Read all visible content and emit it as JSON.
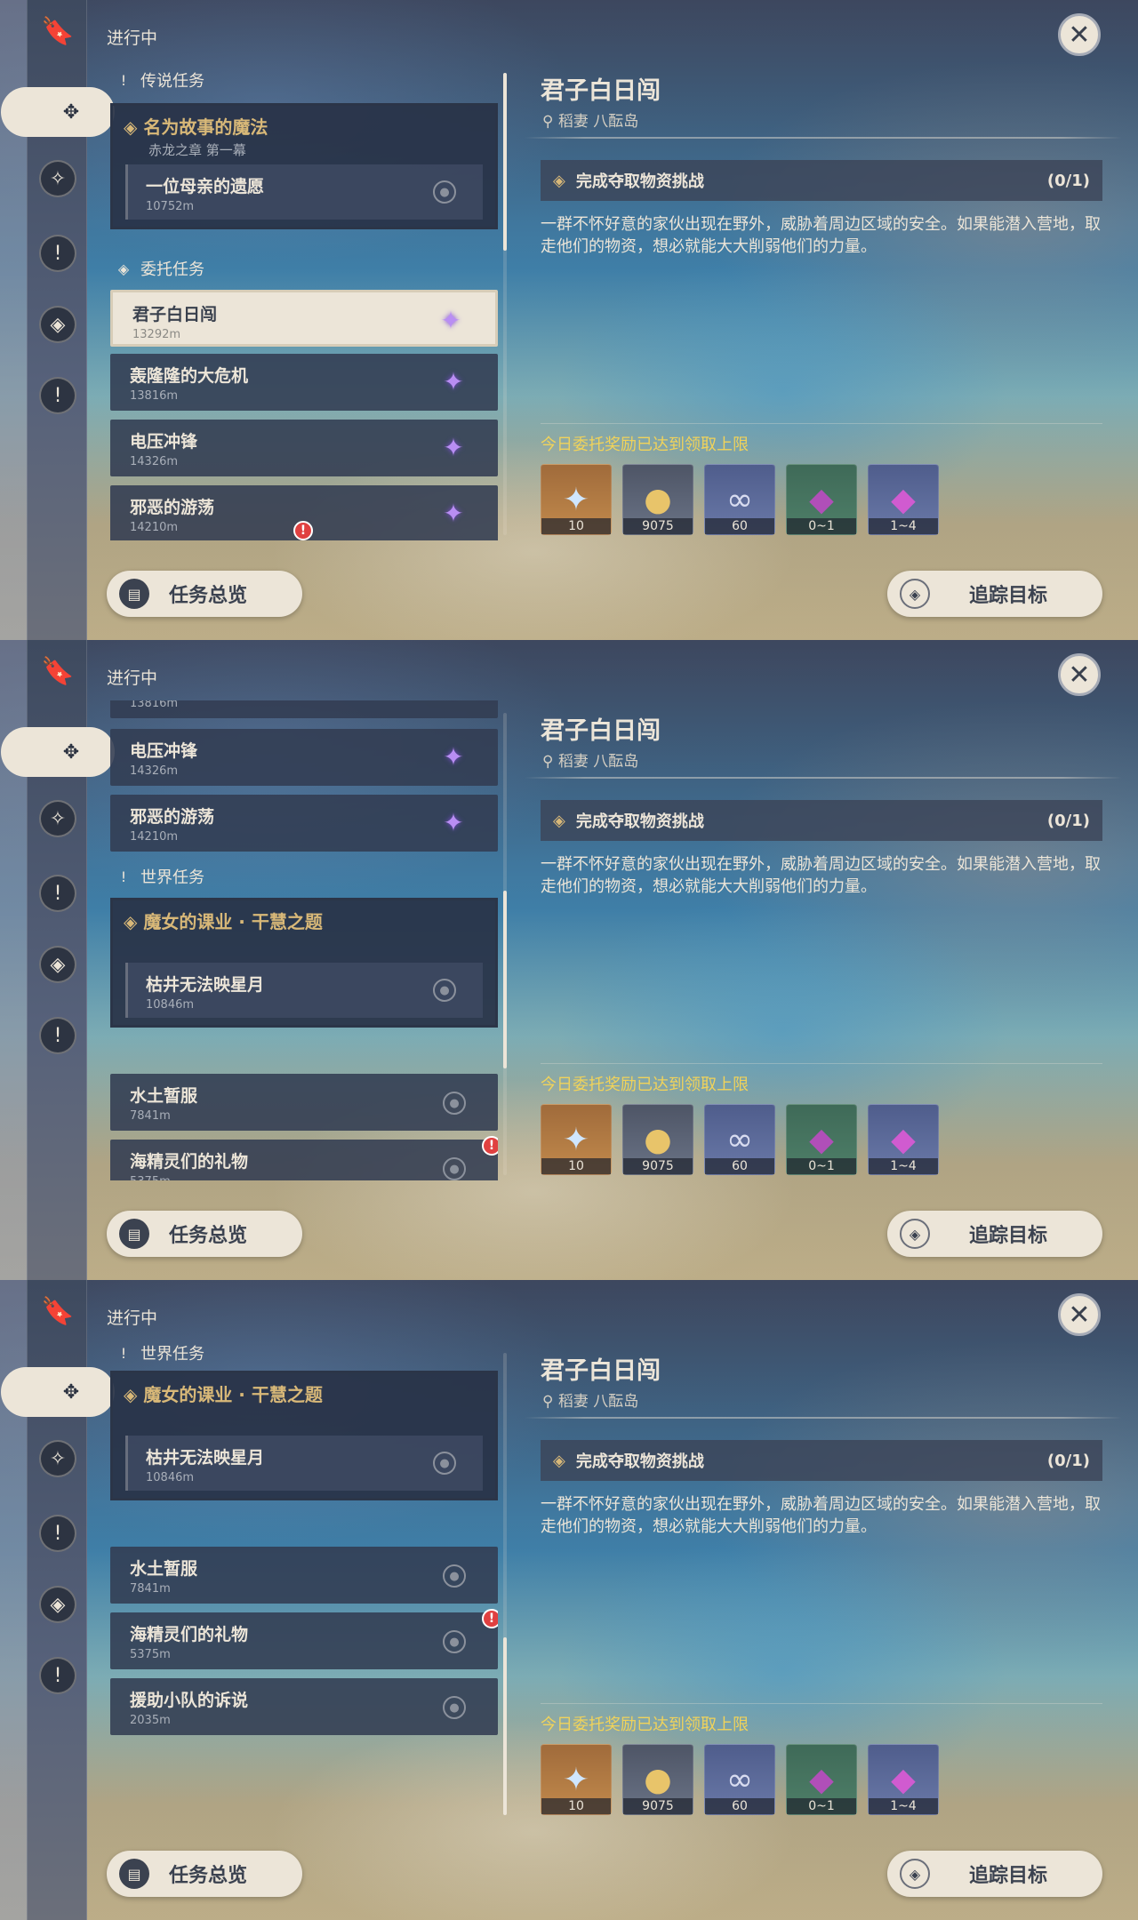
{
  "header": {
    "in_progress": "进行中",
    "close_icon": "close-icon"
  },
  "sidebar": {
    "icons": [
      "bookmark-icon",
      "quest-all-icon",
      "archon-icon",
      "story-icon",
      "commission-icon",
      "world-icon"
    ]
  },
  "sections": {
    "archon": "传说任务",
    "commission": "委托任务",
    "world": "世界任务"
  },
  "quests": {
    "archon_main": {
      "title": "名为故事的魔法",
      "subtitle": "赤龙之章 第一幕"
    },
    "archon_sub": {
      "title": "一位母亲的遗愿",
      "dist": "10752m"
    },
    "c1": {
      "title": "君子白日闯",
      "dist": "13292m"
    },
    "c2": {
      "title": "轰隆隆的大危机",
      "dist": "13816m"
    },
    "c3": {
      "title": "电压冲锋",
      "dist": "14326m"
    },
    "c4": {
      "title": "邪恶的游荡",
      "dist": "14210m"
    },
    "world_main": {
      "title": "魔女的课业 · 干慧之题"
    },
    "world_sub": {
      "title": "枯井无法映星月",
      "dist": "10846m"
    },
    "w2": {
      "title": "水土暂服",
      "dist": "7841m"
    },
    "w3": {
      "title": "海精灵们的礼物",
      "dist": "5375m"
    },
    "w4": {
      "title": "援助小队的诉说",
      "dist": "2035m"
    }
  },
  "detail": {
    "title": "君子白日闯",
    "location": "稻妻 八酝岛",
    "objective": "完成夺取物资挑战",
    "progress": "(0/1)",
    "description": "一群不怀好意的家伙出现在野外，威胁着周边区域的安全。如果能潜入营地，取走他们的物资，想必就能大大削弱他们的力量。",
    "reward_note": "今日委托奖励已达到领取上限",
    "rewards": [
      {
        "icon": "primogem-icon",
        "count": "10"
      },
      {
        "icon": "mora-icon",
        "count": "9075"
      },
      {
        "icon": "companionship-icon",
        "count": "60"
      },
      {
        "icon": "crystal-green-icon",
        "count": "0~1"
      },
      {
        "icon": "crystal-purple-icon",
        "count": "1~4"
      }
    ]
  },
  "buttons": {
    "overview": "任务总览",
    "track": "追踪目标"
  },
  "scroll": {
    "panel1": 0.0,
    "panel2": 0.6,
    "panel3": 1.0
  }
}
